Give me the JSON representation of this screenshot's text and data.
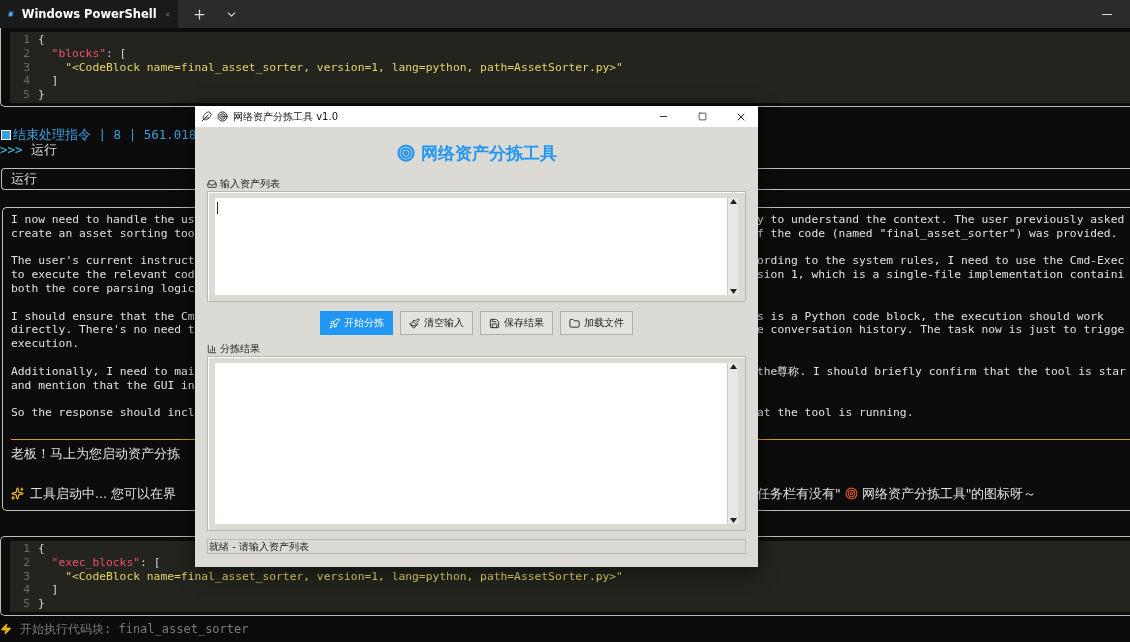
{
  "tab_bar": {
    "tabs": [
      {
        "title": "Windows PowerShell",
        "selected": true
      }
    ]
  },
  "code_block_top": {
    "lines": [
      {
        "number": "1",
        "tokens": [
          {
            "kind": "punct",
            "text": "{"
          }
        ]
      },
      {
        "number": "2",
        "tokens": [
          {
            "kind": "key",
            "text": "  \"blocks\""
          },
          {
            "kind": "punct",
            "text": ": ["
          }
        ]
      },
      {
        "number": "3",
        "tokens": [
          {
            "kind": "string",
            "text": "    \"<CodeBlock name=final_asset_sorter, version=1, lang=python, path=AssetSorter.py>\""
          }
        ]
      },
      {
        "number": "4",
        "tokens": [
          {
            "kind": "punct",
            "text": "  ]"
          }
        ]
      },
      {
        "number": "5",
        "tokens": [
          {
            "kind": "punct",
            "text": "}"
          }
        ]
      }
    ]
  },
  "status_line": {
    "text": "结束处理指令 | 8 | 561.018"
  },
  "prompt": {
    "symbol": ">>>",
    "command": "运行"
  },
  "input_echo": {
    "text": "运行"
  },
  "response": {
    "paragraphs": [
      {
        "lines": [
          {
            "left": "I now need to handle the us",
            "right": "y to understand the context. The user previously asked"
          },
          {
            "left": "create an asset sorting too",
            "right": "f the code (named \"final_asset_sorter\") was provided."
          }
        ]
      },
      {
        "lines": [
          {
            "left": "The user's current instruct",
            "right": "ording to the system rules, I need to use the Cmd-Exec"
          },
          {
            "left": "to execute the relevant cod",
            "right": "sion 1, which is a single-file implementation containi"
          },
          {
            "left": "both the core parsing logic"
          }
        ]
      },
      {
        "lines": [
          {
            "left": "I should ensure that the Cm",
            "right": "s is a Python code block, the execution should work"
          },
          {
            "left": "directly. There's no need t",
            "right": "e conversation history. The task now is just to trigge"
          },
          {
            "left": "execution."
          }
        ]
      },
      {
        "lines": [
          {
            "left": "Additionally, I need to mai",
            "right": "the尊称. I should briefly confirm that the tool is star"
          },
          {
            "left": "and mention that the GUI in"
          }
        ]
      },
      {
        "lines": [
          {
            "left": "So the response should incl",
            "right": "at the tool is running."
          }
        ]
      }
    ],
    "reply": {
      "greeting": "老板！马上为您启动资产分拣",
      "status_left": "工具启动中... 您可以在界",
      "status_right_start": "任务栏有没有\"",
      "status_right_end": "网络资产分拣工具\"的图标呀～"
    }
  },
  "code_block_bottom": {
    "lines": [
      {
        "number": "1",
        "tokens": [
          {
            "kind": "punct",
            "text": "{"
          }
        ]
      },
      {
        "number": "2",
        "tokens": [
          {
            "kind": "key",
            "text": "  \"exec_blocks\""
          },
          {
            "kind": "punct",
            "text": ": ["
          }
        ]
      },
      {
        "number": "3",
        "tokens": [
          {
            "kind": "string",
            "text": "    \"<CodeBlock name=final_asset_sorter, version=1, lang=python, path=AssetSorter.py>\""
          }
        ]
      },
      {
        "number": "4",
        "tokens": [
          {
            "kind": "punct",
            "text": "  ]"
          }
        ]
      },
      {
        "number": "5",
        "tokens": [
          {
            "kind": "punct",
            "text": "}"
          }
        ]
      }
    ]
  },
  "footer": {
    "text": "开始执行代码块: final_asset_sorter"
  },
  "dialog": {
    "title": "网络资产分拣工具 v1.0",
    "heading": "网络资产分拣工具",
    "input_label": "输入资产列表",
    "buttons": [
      {
        "label": "开始分拣",
        "primary": true
      },
      {
        "label": "清空输入",
        "primary": false
      },
      {
        "label": "保存结果",
        "primary": false
      },
      {
        "label": "加载文件",
        "primary": false
      }
    ],
    "result_label": "分拣结果",
    "status": "就绪 - 请输入资产列表"
  }
}
